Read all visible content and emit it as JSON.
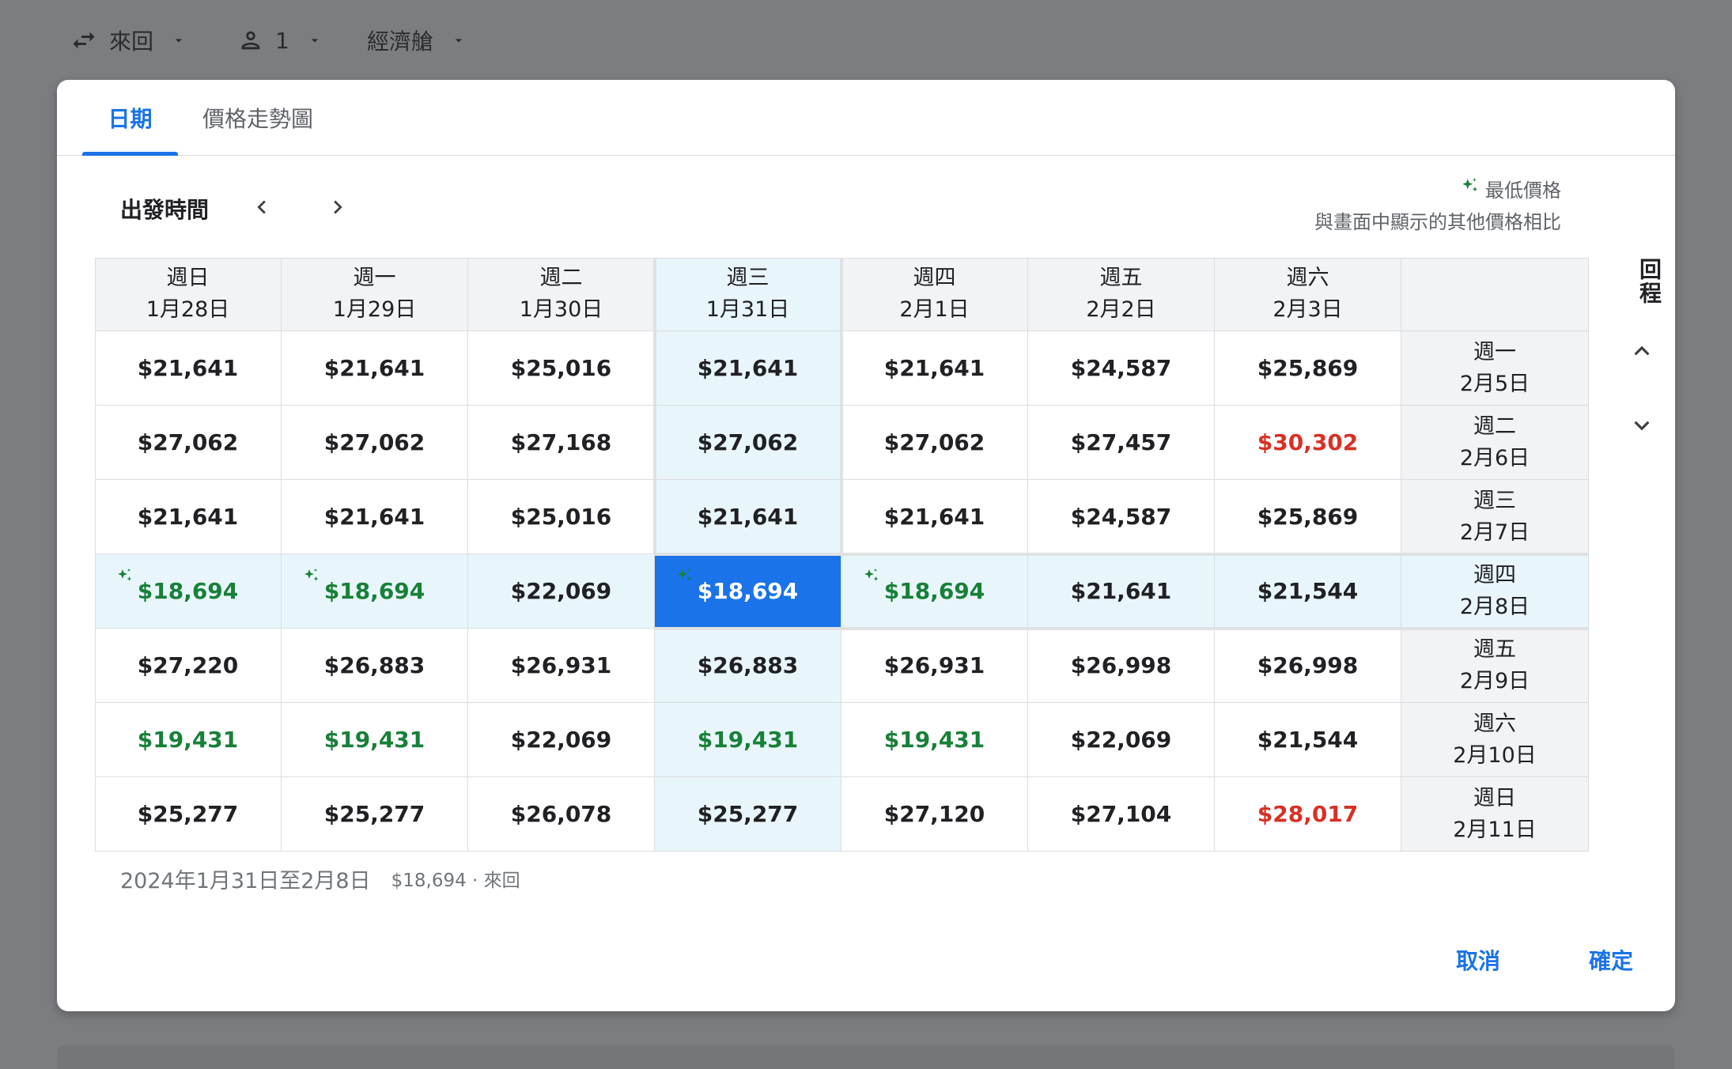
{
  "topbar": {
    "trip_type": "來回",
    "passengers": "1",
    "cabin": "經濟艙"
  },
  "tabs": [
    {
      "label": "日期",
      "active": true
    },
    {
      "label": "價格走勢圖",
      "active": false
    }
  ],
  "departure_label": "出發時間",
  "return_label": "回程",
  "legend": {
    "title": "最低價格",
    "subtitle": "與畫面中顯示的其他價格相比"
  },
  "columns": [
    {
      "weekday": "週日",
      "date": "1月28日"
    },
    {
      "weekday": "週一",
      "date": "1月29日"
    },
    {
      "weekday": "週二",
      "date": "1月30日"
    },
    {
      "weekday": "週三",
      "date": "1月31日"
    },
    {
      "weekday": "週四",
      "date": "2月1日"
    },
    {
      "weekday": "週五",
      "date": "2月2日"
    },
    {
      "weekday": "週六",
      "date": "2月3日"
    }
  ],
  "rows": [
    {
      "weekday": "週一",
      "date": "2月5日",
      "prices": [
        "$21,641",
        "$21,641",
        "$25,016",
        "$21,641",
        "$21,641",
        "$24,587",
        "$25,869"
      ]
    },
    {
      "weekday": "週二",
      "date": "2月6日",
      "prices": [
        "$27,062",
        "$27,062",
        "$27,168",
        "$27,062",
        "$27,062",
        "$27,457",
        "$30,302"
      ]
    },
    {
      "weekday": "週三",
      "date": "2月7日",
      "prices": [
        "$21,641",
        "$21,641",
        "$25,016",
        "$21,641",
        "$21,641",
        "$24,587",
        "$25,869"
      ]
    },
    {
      "weekday": "週四",
      "date": "2月8日",
      "prices": [
        "$18,694",
        "$18,694",
        "$22,069",
        "$18,694",
        "$18,694",
        "$21,641",
        "$21,544"
      ]
    },
    {
      "weekday": "週五",
      "date": "2月9日",
      "prices": [
        "$27,220",
        "$26,883",
        "$26,931",
        "$26,883",
        "$26,931",
        "$26,998",
        "$26,998"
      ]
    },
    {
      "weekday": "週六",
      "date": "2月10日",
      "prices": [
        "$19,431",
        "$19,431",
        "$22,069",
        "$19,431",
        "$19,431",
        "$22,069",
        "$21,544"
      ]
    },
    {
      "weekday": "週日",
      "date": "2月11日",
      "prices": [
        "$25,277",
        "$25,277",
        "$26,078",
        "$25,277",
        "$27,120",
        "$27,104",
        "$28,017"
      ]
    }
  ],
  "price_styles": {
    "lowest": [
      [
        3,
        0
      ],
      [
        3,
        1
      ],
      [
        3,
        3
      ],
      [
        3,
        4
      ]
    ],
    "green": [
      [
        5,
        0
      ],
      [
        5,
        1
      ],
      [
        5,
        3
      ],
      [
        5,
        4
      ]
    ],
    "red": [
      [
        1,
        6
      ],
      [
        6,
        6
      ]
    ]
  },
  "selection": {
    "row": 3,
    "col": 3
  },
  "summary": {
    "dates": "2024年1月31日至2月8日",
    "price": "$18,694 · 來回"
  },
  "actions": {
    "cancel": "取消",
    "confirm": "確定"
  },
  "colors": {
    "accent": "#1a73e8",
    "green": "#188038",
    "red": "#d93025",
    "lowest_bg": "#e6f4ea",
    "highlight_bg": "#e8f6fb"
  }
}
